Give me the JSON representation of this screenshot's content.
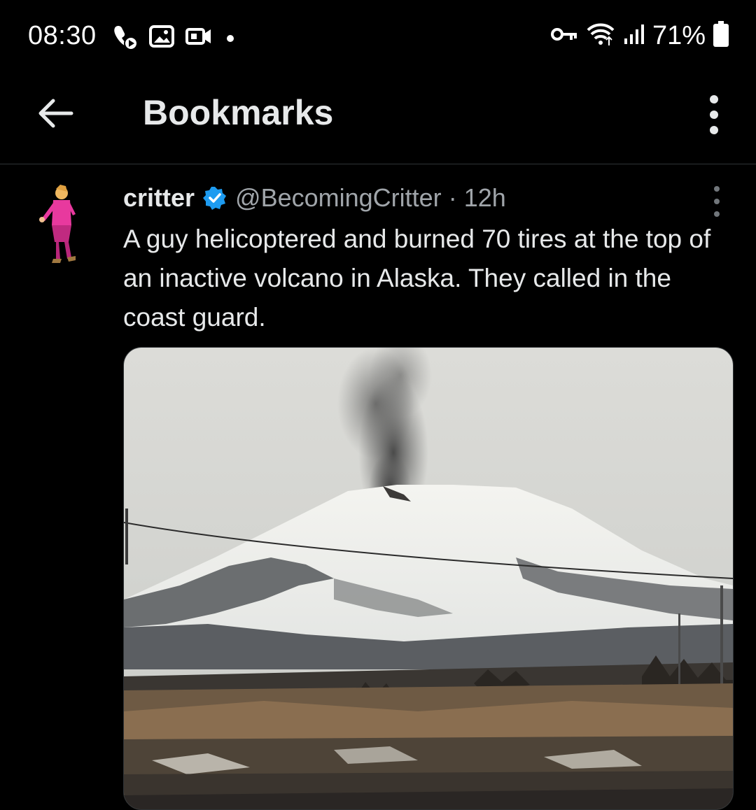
{
  "status_bar": {
    "time": "08:30",
    "battery": "71%",
    "left_icons": [
      "phone-play-icon",
      "gallery-icon",
      "video-icon",
      "dot"
    ],
    "right_icons": [
      "vpn-key-icon",
      "wifi-icon",
      "signal-icon",
      "battery-icon"
    ]
  },
  "header": {
    "title": "Bookmarks",
    "back_icon": "arrow-left-icon",
    "more_icon": "more-vertical-icon"
  },
  "tweet": {
    "author_name": "critter",
    "verified": true,
    "handle": "@BecomingCritter",
    "separator": "·",
    "time": "12h",
    "text": "A guy helicoptered and burned 70 tires at the top of an inactive volcano in Alaska. They called in the coast guard.",
    "media_icon": "photo-snowy-volcano-smoke"
  },
  "colors": {
    "background": "#000000",
    "text": "#e7e9ea",
    "secondary_text": "#a0a5aa",
    "verified_blue": "#1d9bf0",
    "divider": "#2f3336"
  }
}
